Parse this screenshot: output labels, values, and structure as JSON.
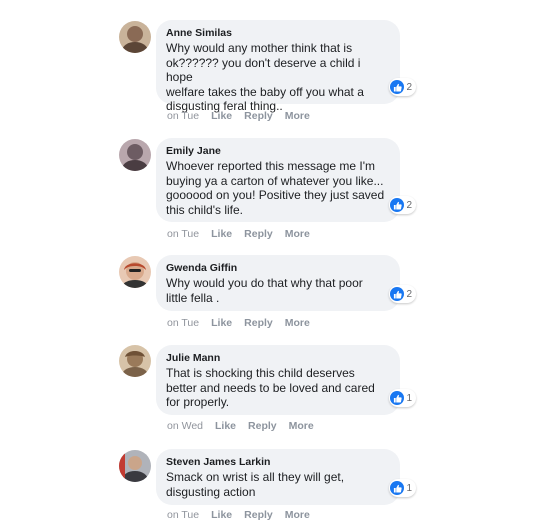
{
  "comments": [
    {
      "author": "Anne Similas",
      "text": "Why would any mother think that is\nok?????? you don't deserve a child i hope\nwelfare takes the baby off you what a\ndisgusting feral thing..",
      "reactions": "2",
      "time": "on Tue",
      "like": "Like",
      "reply": "Reply",
      "more": "More",
      "avatar_color": "#8a6a55"
    },
    {
      "author": "Emily Jane",
      "text": "Whoever reported this message me I'm\nbuying ya a carton of whatever you like...\ngoooood on you! Positive they just saved\nthis child's life.",
      "reactions": "2",
      "time": "on Tue",
      "like": "Like",
      "reply": "Reply",
      "more": "More",
      "avatar_color": "#6d5c63"
    },
    {
      "author": "Gwenda Giffin",
      "text": "Why would you do that why that poor\nlittle fella .",
      "reactions": "2",
      "time": "on Tue",
      "like": "Like",
      "reply": "Reply",
      "more": "More",
      "avatar_color": "#b84a2e"
    },
    {
      "author": "Julie Mann",
      "text": "That is shocking this child deserves\nbetter and needs to be loved and cared\nfor properly.",
      "reactions": "1",
      "time": "on Wed",
      "like": "Like",
      "reply": "Reply",
      "more": "More",
      "avatar_color": "#9a7a5a"
    },
    {
      "author": "Steven James Larkin",
      "text": "Smack on wrist is all they will get,\ndisgusting action",
      "reactions": "1",
      "time": "on Tue",
      "like": "Like",
      "reply": "Reply",
      "more": "More",
      "avatar_color": "#3a3a40"
    }
  ],
  "colors": {
    "bubble": "#f0f2f5",
    "like_blue": "#1877f2",
    "muted": "#90949c"
  }
}
